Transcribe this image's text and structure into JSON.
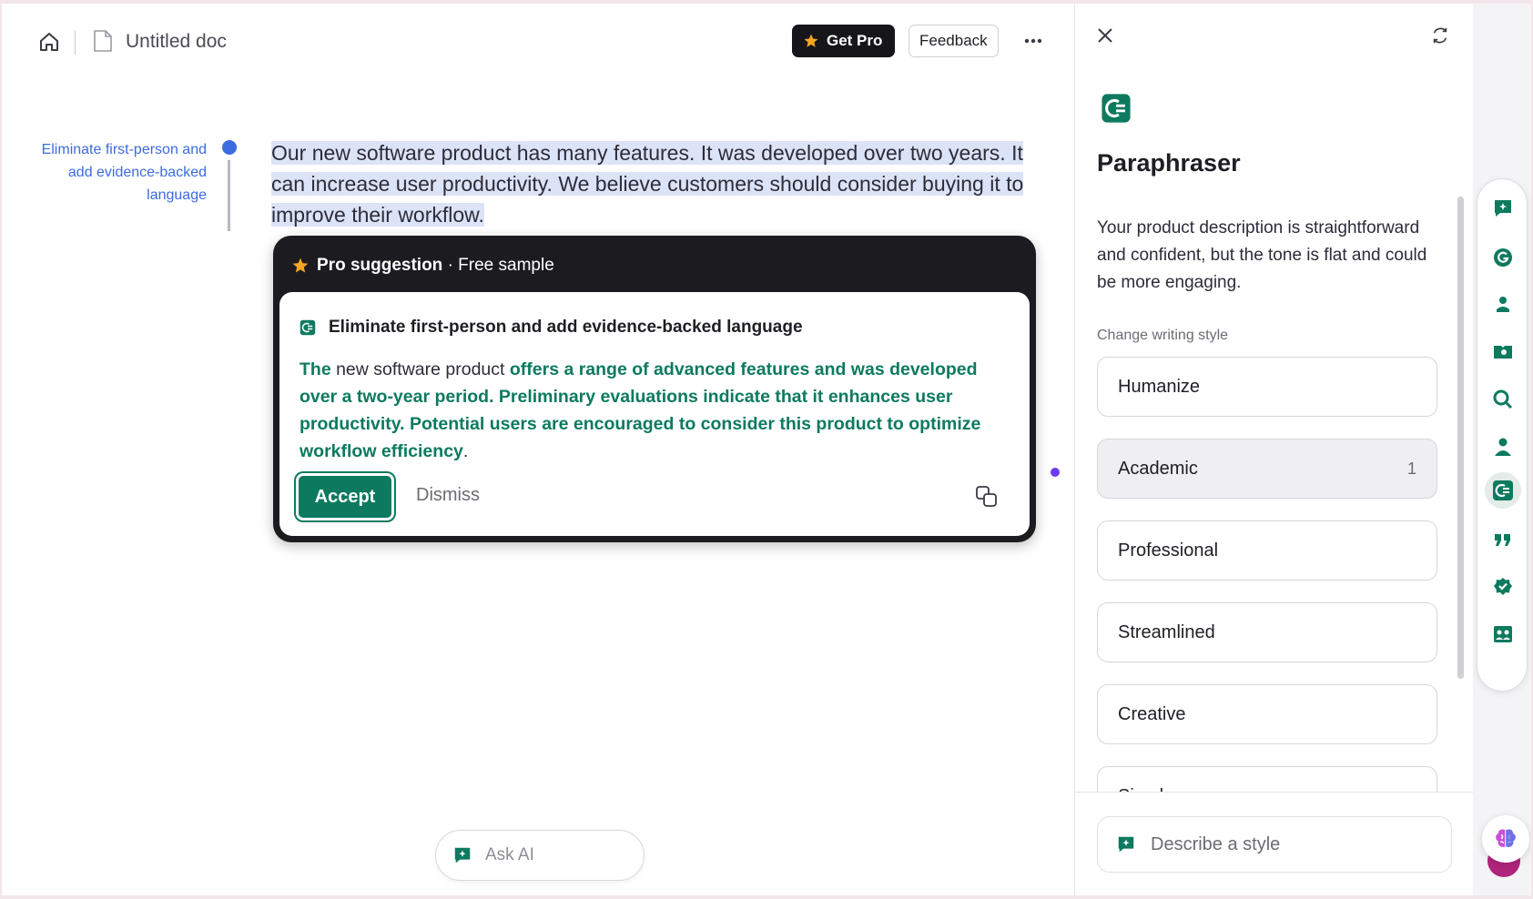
{
  "topbar": {
    "doc_title": "Untitled doc",
    "get_pro_label": "Get Pro",
    "feedback_label": "Feedback"
  },
  "editor": {
    "side_note": "Eliminate first-person and add evidence-backed language",
    "text": "Our new software product has many features. It was developed over two years. It can increase user productivity. We believe customers should consider buying it to improve their workflow."
  },
  "suggestion": {
    "header_bold": "Pro suggestion",
    "header_rest": " · Free sample",
    "title": "Eliminate first-person and add evidence-backed language",
    "segments": [
      {
        "text": "The",
        "added": true
      },
      {
        "text": " new software product ",
        "added": false
      },
      {
        "text": "offers a range of advanced features and was developed over a two-year period. Preliminary evaluations indicate that it enhances user productivity. Potential users are encouraged to consider this product to optimize workflow efficiency",
        "added": true
      },
      {
        "text": ".",
        "added": false
      }
    ],
    "accept_label": "Accept",
    "dismiss_label": "Dismiss"
  },
  "ask_ai": {
    "placeholder": "Ask AI"
  },
  "panel": {
    "title": "Paraphraser",
    "description": "Your product description is straightforward and confident, but the tone is flat and could be more engaging.",
    "style_label": "Change writing style",
    "styles": [
      {
        "label": "Humanize",
        "count": "",
        "active": false
      },
      {
        "label": "Academic",
        "count": "1",
        "active": true
      },
      {
        "label": "Professional",
        "count": "",
        "active": false
      },
      {
        "label": "Streamlined",
        "count": "",
        "active": false
      },
      {
        "label": "Creative",
        "count": "",
        "active": false
      },
      {
        "label": "Simple",
        "count": "",
        "active": false
      }
    ],
    "describe_placeholder": "Describe a style"
  },
  "rail": {
    "items": [
      "chat-sparkle-icon",
      "grammarly-icon",
      "reader-reactions-icon",
      "citation-finder-icon",
      "ai-detector-icon",
      "expert-review-icon",
      "paraphraser-icon",
      "quote-icon",
      "proofreader-icon",
      "plagiarism-icon"
    ],
    "active": "paraphraser-icon"
  },
  "colors": {
    "accent_green": "#0d7a5f",
    "highlight_blue": "#dde3f6",
    "note_blue": "#3d6be0",
    "pro_star": "#f5a623"
  }
}
